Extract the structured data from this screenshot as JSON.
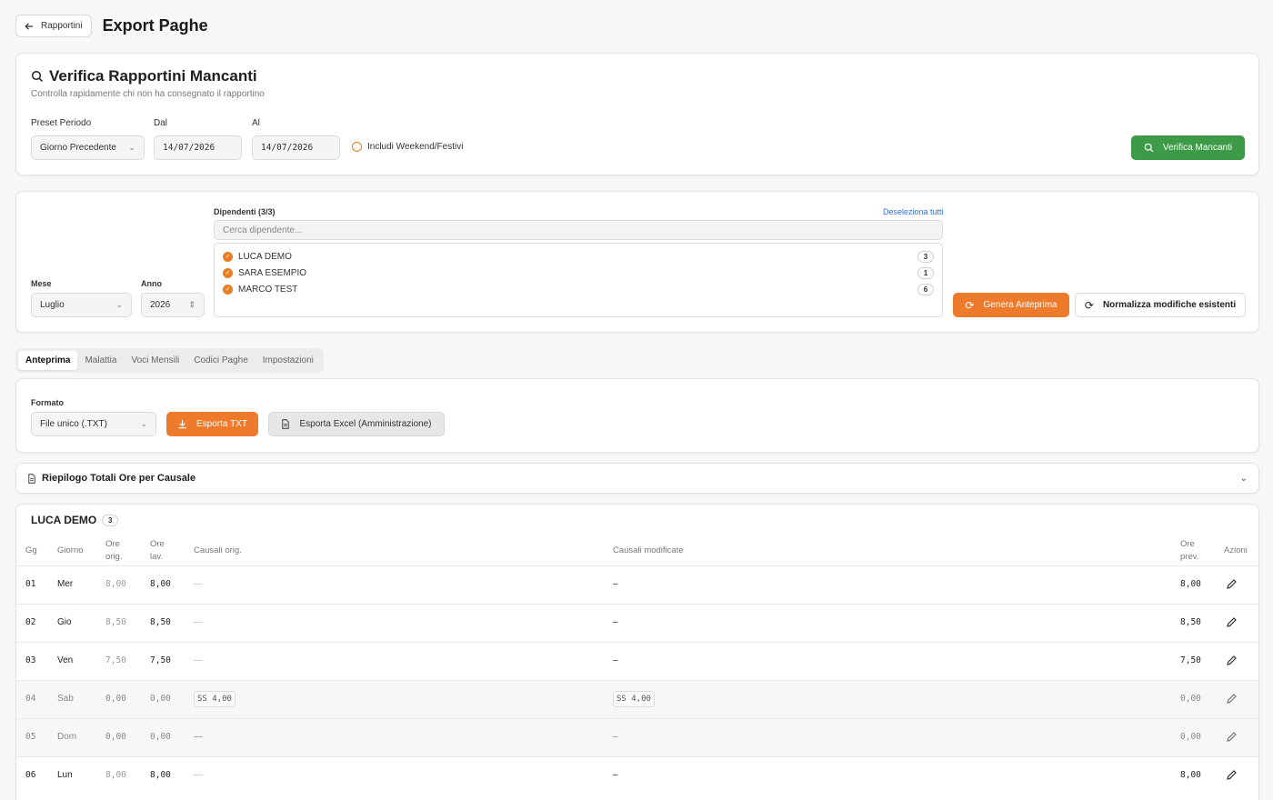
{
  "header": {
    "back_label": "Rapportini",
    "title": "Export Paghe"
  },
  "verify": {
    "title": "Verifica Rapportini Mancanti",
    "subtitle": "Controlla rapidamente chi non ha consegnato il rapportino",
    "preset_label": "Preset Periodo",
    "preset_value": "Giorno Precedente",
    "from_label": "Dal",
    "from_value": "14/07/2026",
    "to_label": "Al",
    "to_value": "14/07/2026",
    "weekend_label": "Includi Weekend/Festivi",
    "button": "Verifica Mancanti"
  },
  "selection": {
    "month_label": "Mese",
    "month_value": "Luglio",
    "year_label": "Anno",
    "year_value": "2026",
    "employees_label": "Dipendenti (3/3)",
    "deselect_label": "Deseleziona tutti",
    "search_placeholder": "Cerca dipendente...",
    "employees": [
      {
        "name": "LUCA DEMO",
        "count": "3"
      },
      {
        "name": "SARA ESEMPIO",
        "count": "1"
      },
      {
        "name": "MARCO TEST",
        "count": "6"
      }
    ],
    "generate_button": "Genera Anteprima",
    "normalize_button": "Normalizza modifiche esistenti"
  },
  "tabs": [
    "Anteprima",
    "Malattia",
    "Voci Mensili",
    "Codici Paghe",
    "Impostazioni"
  ],
  "export": {
    "format_label": "Formato",
    "format_value": "File unico (.TXT)",
    "txt_button": "Esporta TXT",
    "excel_button": "Esporta Excel (Amministrazione)"
  },
  "summary": {
    "title": "Riepilogo Totali Ore per Causale"
  },
  "table": {
    "employee": "LUCA DEMO",
    "employee_count": "3",
    "headers": {
      "gg": "Gg",
      "giorno": "Giorno",
      "ore_orig_1": "Ore",
      "ore_orig_2": "orig.",
      "ore_lav_1": "Ore",
      "ore_lav_2": "lav.",
      "causali_orig": "Causali orig.",
      "causali_mod": "Causali modificate",
      "ore_prev_1": "Ore",
      "ore_prev_2": "prev.",
      "azioni": "Azioni"
    },
    "rows": [
      {
        "gg": "01",
        "giorno": "Mer",
        "ore_orig": "8,00",
        "ore_lav": "8,00",
        "causali_orig": "—",
        "causali_mod": "–",
        "ore_prev": "8,00"
      },
      {
        "gg": "02",
        "giorno": "Gio",
        "ore_orig": "8,50",
        "ore_lav": "8,50",
        "causali_orig": "—",
        "causali_mod": "–",
        "ore_prev": "8,50"
      },
      {
        "gg": "03",
        "giorno": "Ven",
        "ore_orig": "7,50",
        "ore_lav": "7,50",
        "causali_orig": "—",
        "causali_mod": "–",
        "ore_prev": "7,50"
      },
      {
        "gg": "04",
        "giorno": "Sab",
        "ore_orig": "0,00",
        "ore_lav": "0,00",
        "causali_orig": "SS 4,00",
        "causali_mod": "SS 4,00",
        "ore_prev": "0,00"
      },
      {
        "gg": "05",
        "giorno": "Dom",
        "ore_orig": "0,00",
        "ore_lav": "0,00",
        "causali_orig": "—",
        "causali_mod": "–",
        "ore_prev": "0,00"
      },
      {
        "gg": "06",
        "giorno": "Lun",
        "ore_orig": "8,00",
        "ore_lav": "8,00",
        "causali_orig": "—",
        "causali_mod": "–",
        "ore_prev": "8,00"
      }
    ]
  },
  "colors": {
    "accent_orange": "#ee7b2c",
    "accent_green": "#3d9a47",
    "link_blue": "#2f6fd6"
  }
}
